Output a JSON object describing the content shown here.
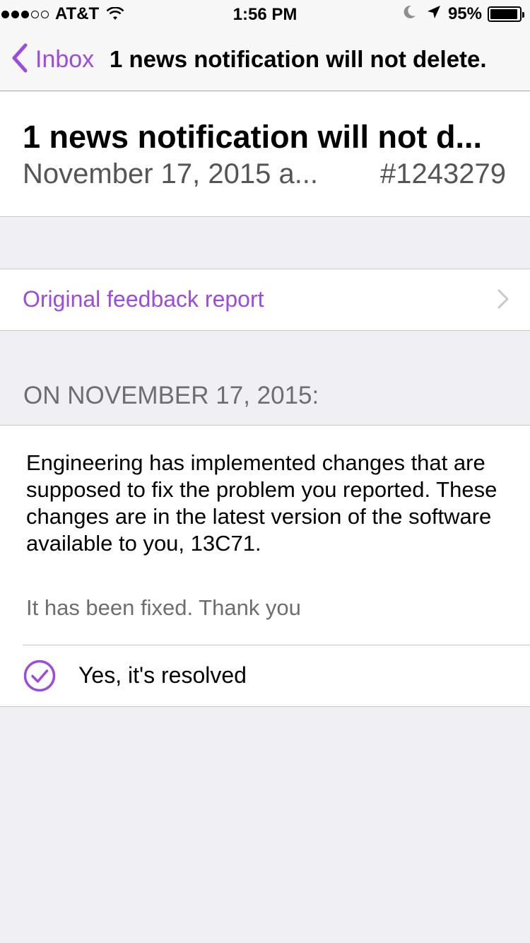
{
  "status_bar": {
    "carrier": "AT&T",
    "time": "1:56 PM",
    "battery_percent": "95%",
    "signal_strength": 3,
    "signal_max": 5,
    "battery_level": 0.95,
    "icons": [
      "wifi-icon",
      "moon-icon",
      "location-arrow-icon",
      "battery-icon"
    ]
  },
  "nav": {
    "back_label": "Inbox",
    "title": "1 news notification will not delete."
  },
  "header": {
    "title": "1 news notification will not d...",
    "date": "November 17, 2015 a...",
    "id": "#1243279"
  },
  "feedback": {
    "label": "Original feedback report"
  },
  "section": {
    "title": "ON NOVEMBER 17, 2015:"
  },
  "response": {
    "body": "Engineering has implemented changes that are supposed to fix the problem you reported. These changes are in the latest version of the software available to you, 13C71.",
    "note": "It has been fixed. Thank you",
    "resolved_label": "Yes, it's resolved"
  },
  "colors": {
    "accent": "#9b4cde",
    "background": "#efeff4",
    "secondary_text": "#6d6d72"
  }
}
